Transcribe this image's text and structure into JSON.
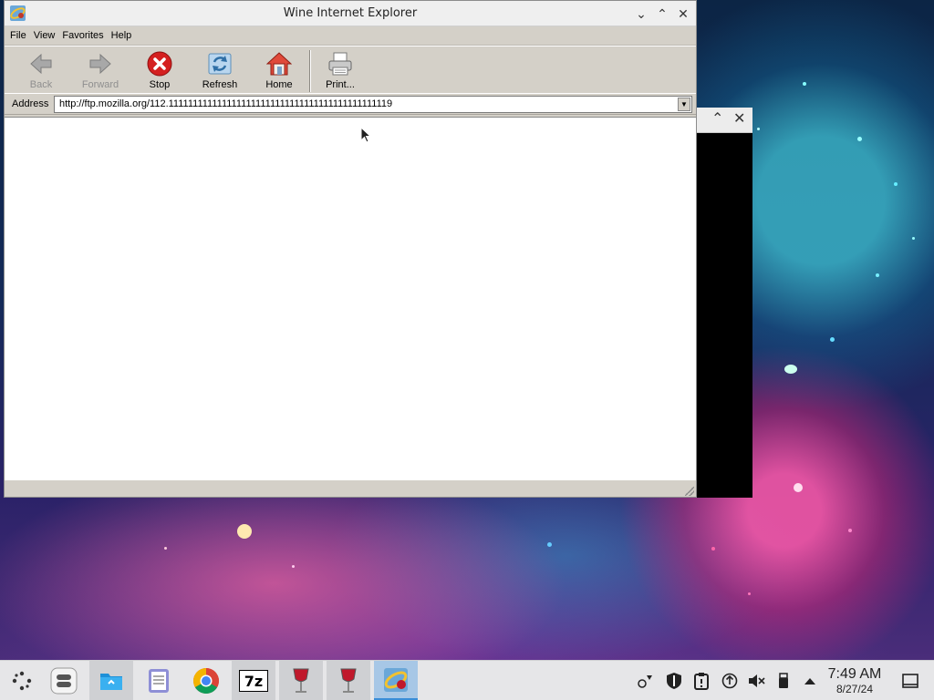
{
  "window": {
    "title": "Wine Internet Explorer",
    "controls": {
      "minimize": "⌄",
      "maximize": "⌃",
      "close": "✕"
    }
  },
  "menu": [
    "File",
    "View",
    "Favorites",
    "Help"
  ],
  "toolbar": {
    "back": "Back",
    "forward": "Forward",
    "stop": "Stop",
    "refresh": "Refresh",
    "home": "Home",
    "print": "Print..."
  },
  "address": {
    "label": "Address",
    "url": "http://ftp.mozilla.org/112.1111111111111111111111111111111111111111111119"
  },
  "background_window": {
    "maximize": "⌃",
    "close": "✕"
  },
  "taskbar": {
    "apps": [
      "application-launcher",
      "overview",
      "dolphin-file-manager",
      "text-editor",
      "google-chrome",
      "7-zip",
      "wine-app",
      "wine-app",
      "wine-internet-explorer"
    ],
    "clock_time": "7:49 AM",
    "clock_date": "8/27/24"
  },
  "colors": {
    "taskbar_bg": "#e6e6e8",
    "focused_task": "#a7c7e6",
    "stop_red": "#d42020"
  }
}
